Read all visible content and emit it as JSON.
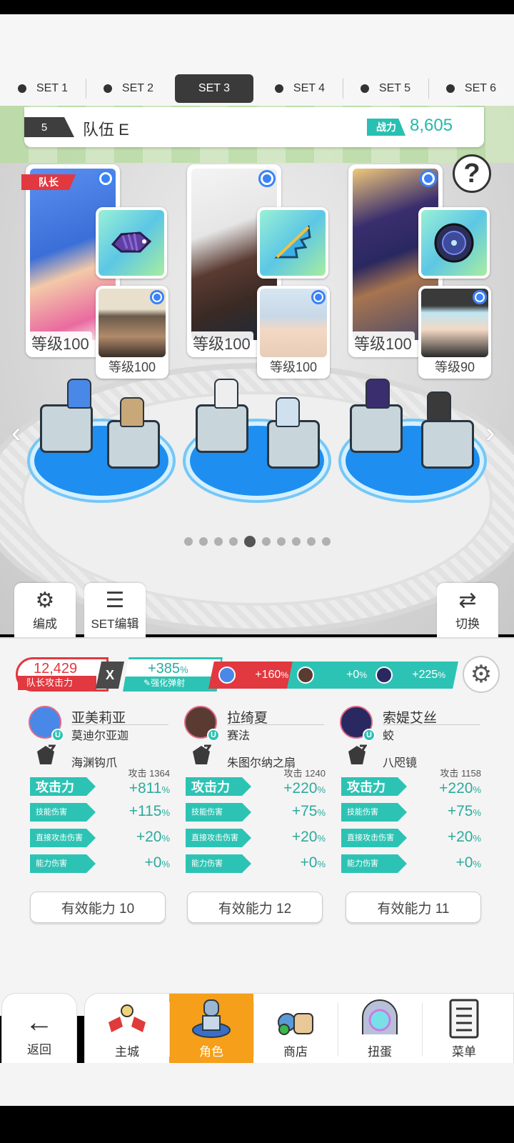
{
  "set_tabs": [
    {
      "label": "SET 1",
      "active": false
    },
    {
      "label": "SET 2",
      "active": false
    },
    {
      "label": "SET 3",
      "active": true
    },
    {
      "label": "SET 4",
      "active": false
    },
    {
      "label": "SET 5",
      "active": false
    },
    {
      "label": "SET 6",
      "active": false
    }
  ],
  "team": {
    "number": "5",
    "name": "队伍 E",
    "power_label": "战力",
    "power_value": "8,605"
  },
  "leader_badge": "队长",
  "help_symbol": "?",
  "characters": [
    {
      "level": "等级100",
      "sub_level": "等级100",
      "name": "亚美莉亚",
      "weapon_name": "莫迪尔亚迦",
      "accessory": "海渊钩爪",
      "base_attack": "攻击 1364",
      "attack_pct": "+811",
      "skill_pct": "+115",
      "direct_pct": "+20",
      "ability_pct": "+0",
      "effective": "有效能力 10",
      "colors": {
        "portrait": "#3b6fd8",
        "hair": "#4a88e8",
        "sub": "#6a5a4a",
        "weapon": "#5f3fa3"
      }
    },
    {
      "level": "等级100",
      "sub_level": "等级100",
      "name": "拉绮夏",
      "weapon_name": "赛法",
      "accessory": "朱图尔纳之扇",
      "base_attack": "攻击 1240",
      "attack_pct": "+220",
      "skill_pct": "+75",
      "direct_pct": "+20",
      "ability_pct": "+0",
      "effective": "有效能力 12",
      "colors": {
        "portrait": "#5a3b32",
        "hair": "#f2f2f2",
        "sub": "#c8d8e8",
        "weapon": "#3bb0e8"
      }
    },
    {
      "level": "等级100",
      "sub_level": "等级90",
      "name": "索媞艾丝",
      "weapon_name": "蛟",
      "accessory": "八咫镜",
      "base_attack": "攻击 1158",
      "attack_pct": "+220",
      "skill_pct": "+75",
      "direct_pct": "+20",
      "ability_pct": "+0",
      "effective": "有效能力 11",
      "colors": {
        "portrait": "#2a2860",
        "hair": "#3a2e6e",
        "sub": "#3a3a3a",
        "weapon": "#2a2f5a"
      }
    }
  ],
  "pager": {
    "count": 10,
    "active_index": 4
  },
  "side_buttons": {
    "formation": "编成",
    "set_edit": "SET编辑",
    "switch": "切换"
  },
  "attack_bar": {
    "leader_attack_value": "12,429",
    "leader_attack_label": "队长攻击力",
    "multiply": "X",
    "boost_value": "+385",
    "boost_label": "强化弹射",
    "bonuses": [
      "+160",
      "+0",
      "+225"
    ],
    "bonus_colors": [
      "#e2383f",
      "#2dc3b4",
      "#2dc3b4"
    ]
  },
  "stat_labels": {
    "attack": "攻击力",
    "skill_damage": "技能伤害",
    "direct_damage": "直接攻击伤害",
    "ability_damage": "能力伤害",
    "percent": "%"
  },
  "nav": {
    "back": "返回",
    "items": [
      {
        "label": "主城",
        "active": false
      },
      {
        "label": "角色",
        "active": true
      },
      {
        "label": "商店",
        "active": false
      },
      {
        "label": "扭蛋",
        "active": false
      },
      {
        "label": "菜单",
        "active": false
      }
    ]
  },
  "arrows": {
    "left": "‹",
    "right": "›"
  }
}
